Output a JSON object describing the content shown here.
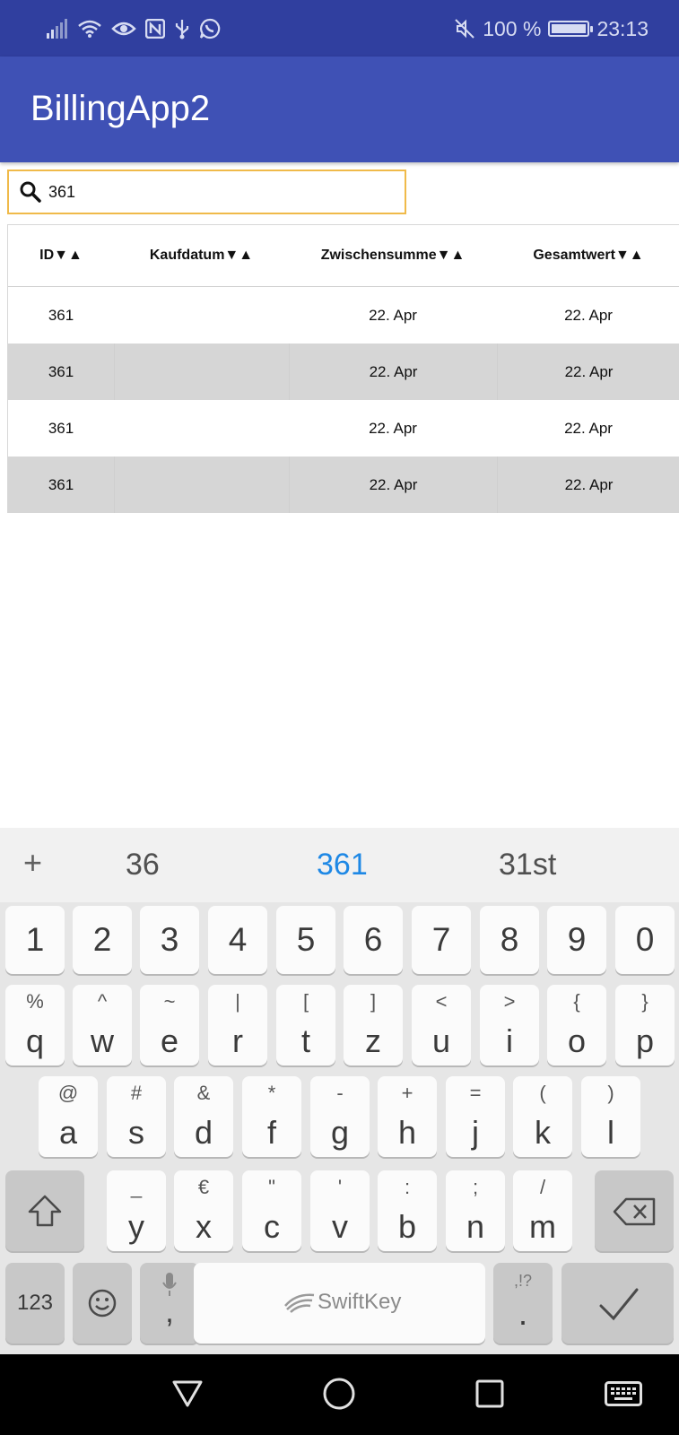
{
  "status_bar": {
    "battery_text": "100 %",
    "battery_level": 100,
    "time": "23:13",
    "icons": [
      "signal-icon",
      "wifi-icon",
      "eye-icon",
      "nfc-icon",
      "usb-icon",
      "whatsapp-icon",
      "mute-icon",
      "battery-icon"
    ]
  },
  "app": {
    "title": "BillingApp2",
    "primary_color": "#3f51b5",
    "status_color": "#303f9f"
  },
  "search": {
    "value": "361",
    "border_color": "#f0ba4a"
  },
  "table": {
    "columns": [
      "ID▼▲",
      "Kaufdatum▼▲",
      "Zwischensumme▼▲",
      "Gesamtwert▼▲"
    ],
    "rows": [
      [
        "361",
        "",
        "22. Apr",
        "22. Apr"
      ],
      [
        "361",
        "",
        "22. Apr",
        "22. Apr"
      ],
      [
        "361",
        "",
        "22. Apr",
        "22. Apr"
      ],
      [
        "361",
        "",
        "22. Apr",
        "22. Apr"
      ]
    ]
  },
  "keyboard": {
    "plus": "+",
    "suggestions": [
      "36",
      "361",
      "31st"
    ],
    "number_row": [
      "1",
      "2",
      "3",
      "4",
      "5",
      "6",
      "7",
      "8",
      "9",
      "0"
    ],
    "row1": [
      {
        "sub": "%",
        "main": "q"
      },
      {
        "sub": "^",
        "main": "w"
      },
      {
        "sub": "~",
        "main": "e"
      },
      {
        "sub": "|",
        "main": "r"
      },
      {
        "sub": "[",
        "main": "t"
      },
      {
        "sub": "]",
        "main": "z"
      },
      {
        "sub": "<",
        "main": "u"
      },
      {
        "sub": ">",
        "main": "i"
      },
      {
        "sub": "{",
        "main": "o"
      },
      {
        "sub": "}",
        "main": "p"
      }
    ],
    "row2": [
      {
        "sub": "@",
        "main": "a"
      },
      {
        "sub": "#",
        "main": "s"
      },
      {
        "sub": "&",
        "main": "d"
      },
      {
        "sub": "*",
        "main": "f"
      },
      {
        "sub": "-",
        "main": "g"
      },
      {
        "sub": "+",
        "main": "h"
      },
      {
        "sub": "=",
        "main": "j"
      },
      {
        "sub": "(",
        "main": "k"
      },
      {
        "sub": ")",
        "main": "l"
      }
    ],
    "row3": [
      {
        "sub": "_",
        "main": "y"
      },
      {
        "sub": "€",
        "main": "x"
      },
      {
        "sub": "\"",
        "main": "c"
      },
      {
        "sub": "'",
        "main": "v"
      },
      {
        "sub": ":",
        "main": "b"
      },
      {
        "sub": ";",
        "main": "n"
      },
      {
        "sub": "/",
        "main": "m"
      }
    ],
    "bottom": {
      "numbers_label": "123",
      "comma": ",",
      "space_label": "SwiftKey",
      "punct_sub": ",!?",
      "period": "."
    }
  }
}
